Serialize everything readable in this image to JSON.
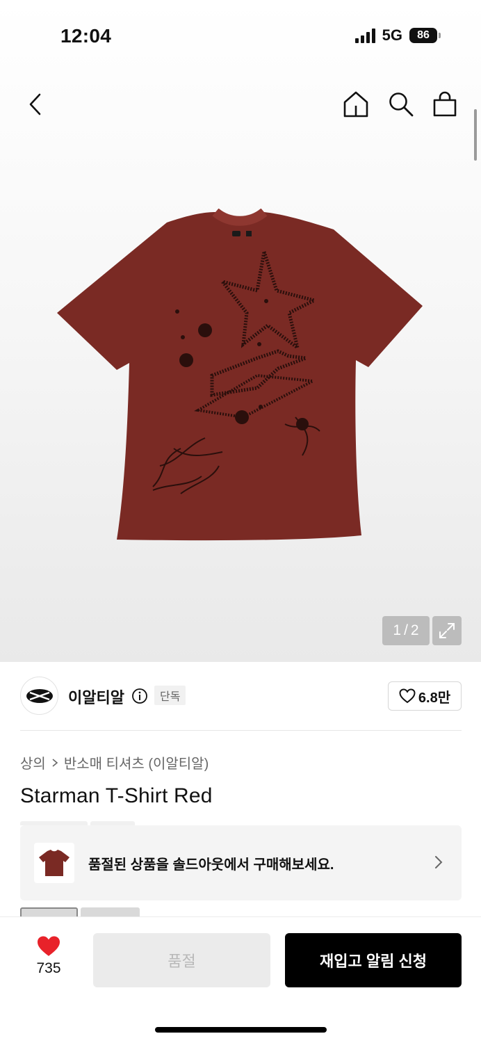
{
  "status_bar": {
    "time": "12:04",
    "network": "5G",
    "battery": "86"
  },
  "nav": {
    "back_icon": "chevron-left-icon",
    "home_icon": "home-icon",
    "search_icon": "search-icon",
    "bag_icon": "shopping-bag-icon"
  },
  "gallery": {
    "current": "1",
    "separator": "/",
    "total": "2",
    "expand_icon": "expand-icon",
    "product_color": "#7a2a24"
  },
  "brand": {
    "name": "이알티알",
    "badge": "단독",
    "likes": "6.8만"
  },
  "breadcrumb": {
    "category": "상의",
    "subcategory": "반소매 티셔츠 (이알티알)"
  },
  "product": {
    "title": "Starman T-Shirt Red"
  },
  "soldout_banner": {
    "text": "품절된 상품을 솔드아웃에서 구매해보세요."
  },
  "bottom_bar": {
    "wish_count": "735",
    "soldout_label": "품절",
    "restock_label": "재입고 알림 신청",
    "heart_color": "#e8222a"
  }
}
